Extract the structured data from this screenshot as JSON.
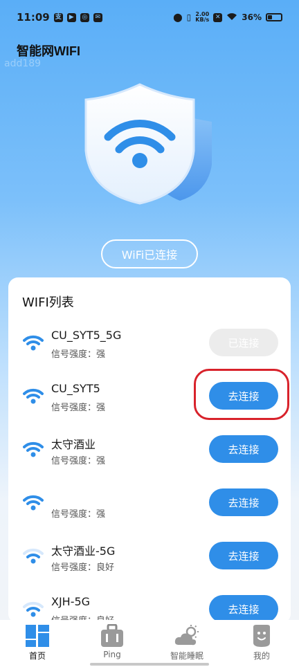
{
  "status_bar": {
    "time": "11:09",
    "net_speed_value": "2.00",
    "net_speed_unit": "KB/s",
    "battery": "36%",
    "battery_level": 0.36
  },
  "app": {
    "title": "智能网WIFI",
    "watermark": "add189"
  },
  "hero": {
    "status_label": "WiFi已连接"
  },
  "wifi_list": {
    "title": "WIFI列表",
    "items": [
      {
        "name": "CU_SYT5_5G",
        "signal": "信号强度：强",
        "button": "已连接",
        "connected": true,
        "strength": "strong"
      },
      {
        "name": "CU_SYT5",
        "signal": "信号强度：强",
        "button": "去连接",
        "connected": false,
        "strength": "strong"
      },
      {
        "name": "太守酒业",
        "signal": "信号强度：强",
        "button": "去连接",
        "connected": false,
        "strength": "strong"
      },
      {
        "name": "",
        "signal": "信号强度：强",
        "button": "去连接",
        "connected": false,
        "strength": "strong"
      },
      {
        "name": "太守酒业-5G",
        "signal": "信号强度：良好",
        "button": "去连接",
        "connected": false,
        "strength": "good"
      },
      {
        "name": "XJH-5G",
        "signal": "信号强度：良好",
        "button": "去连接",
        "connected": false,
        "strength": "good"
      }
    ]
  },
  "tabs": [
    {
      "label": "首页",
      "icon": "home-grid-icon",
      "active": true
    },
    {
      "label": "Ping",
      "icon": "briefcase-icon",
      "active": false
    },
    {
      "label": "智能睡眠",
      "icon": "weather-icon",
      "active": false
    },
    {
      "label": "我的",
      "icon": "profile-face-icon",
      "active": false
    }
  ],
  "colors": {
    "accent": "#2f8ee8",
    "highlight": "#d8222b",
    "wifi_icon": "#2f8ee8"
  }
}
